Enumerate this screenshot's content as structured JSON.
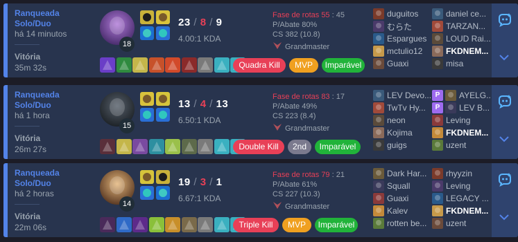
{
  "matches": [
    {
      "queue": "Ranqueada Solo/Duo",
      "ago": "há 14 minutos",
      "result": "Vitória",
      "duration": "35m 32s",
      "champion_level": "18",
      "kills": "23",
      "deaths": "8",
      "assists": "9",
      "kda_ratio": "4.00:1 KDA",
      "kill_participation": "Fase de rotas 55",
      "kp_count": "45",
      "kill_share": "P/Abate 80%",
      "cs": "CS 382 (10.8)",
      "tier": "Grandmaster",
      "badges": [
        {
          "label": "Quadra Kill",
          "color": "#e84057"
        },
        {
          "label": "MVP",
          "color": "#f0a020"
        },
        {
          "label": "Imparável",
          "color": "#21b33a"
        }
      ],
      "team1": [
        {
          "name": "duguitos",
          "me": false
        },
        {
          "name": "むらた",
          "me": false
        },
        {
          "name": "Espargues",
          "me": false
        },
        {
          "name": "mctulio12",
          "me": false
        },
        {
          "name": "Guaxi",
          "me": false
        }
      ],
      "team2": [
        {
          "name": "daniel ce...",
          "me": false
        },
        {
          "name": "TARZAN...",
          "me": false
        },
        {
          "name": "LOUD Rai...",
          "me": false
        },
        {
          "name": "FKDNEM...",
          "me": true
        },
        {
          "name": "misa",
          "me": false
        }
      ]
    },
    {
      "queue": "Ranqueada Solo/Duo",
      "ago": "há 1 hora",
      "result": "Vitória",
      "duration": "26m 27s",
      "champion_level": "15",
      "kills": "13",
      "deaths": "4",
      "assists": "13",
      "kda_ratio": "6.50:1 KDA",
      "kill_participation": "Fase de rotas 83",
      "kp_count": "17",
      "kill_share": "P/Abate 49%",
      "cs": "CS 223 (8.4)",
      "tier": "Grandmaster",
      "badges": [
        {
          "label": "Double Kill",
          "color": "#e84057"
        },
        {
          "label": "2nd",
          "color": "#7b7a8e"
        },
        {
          "label": "Imparável",
          "color": "#21b33a"
        }
      ],
      "team1": [
        {
          "name": "LEV Devo...",
          "me": false
        },
        {
          "name": "TwTv Hy...",
          "me": false
        },
        {
          "name": "neon",
          "me": false
        },
        {
          "name": "Kojima",
          "me": false
        },
        {
          "name": "guigs",
          "me": false
        }
      ],
      "team2": [
        {
          "name": "AYELG...",
          "me": false,
          "tag": "P"
        },
        {
          "name": "LEV B...",
          "me": false,
          "tag": "P"
        },
        {
          "name": "Leving",
          "me": false
        },
        {
          "name": "FKDNEM...",
          "me": true
        },
        {
          "name": "uzent",
          "me": false
        }
      ]
    },
    {
      "queue": "Ranqueada Solo/Duo",
      "ago": "há 2 horas",
      "result": "Vitória",
      "duration": "22m 06s",
      "champion_level": "14",
      "kills": "19",
      "deaths": "3",
      "assists": "1",
      "kda_ratio": "6.67:1 KDA",
      "kill_participation": "Fase de rotas 79",
      "kp_count": "21",
      "kill_share": "P/Abate 61%",
      "cs": "CS 227 (10.3)",
      "tier": "Grandmaster",
      "badges": [
        {
          "label": "Triple Kill",
          "color": "#e84057"
        },
        {
          "label": "MVP",
          "color": "#f0a020"
        },
        {
          "label": "Imparável",
          "color": "#21b33a"
        }
      ],
      "team1": [
        {
          "name": "Dark Har...",
          "me": false
        },
        {
          "name": "Squall",
          "me": false
        },
        {
          "name": "Guaxi",
          "me": false
        },
        {
          "name": "Kalev",
          "me": false
        },
        {
          "name": "rotten be...",
          "me": false
        }
      ],
      "team2": [
        {
          "name": "rhyyzin",
          "me": false
        },
        {
          "name": "Leving",
          "me": false
        },
        {
          "name": "LEGACY ...",
          "me": false
        },
        {
          "name": "FKDNEM...",
          "me": true
        },
        {
          "name": "uzent",
          "me": false
        }
      ]
    }
  ],
  "icons": {
    "ai": "ai-assistant-icon",
    "expand": "chevron-down-icon",
    "rank": "grandmaster-emblem-icon"
  },
  "colors": {
    "win_accent": "#5383e8",
    "card_bg": "#28344e",
    "side_bg": "#2f436e",
    "death": "#e84057"
  }
}
